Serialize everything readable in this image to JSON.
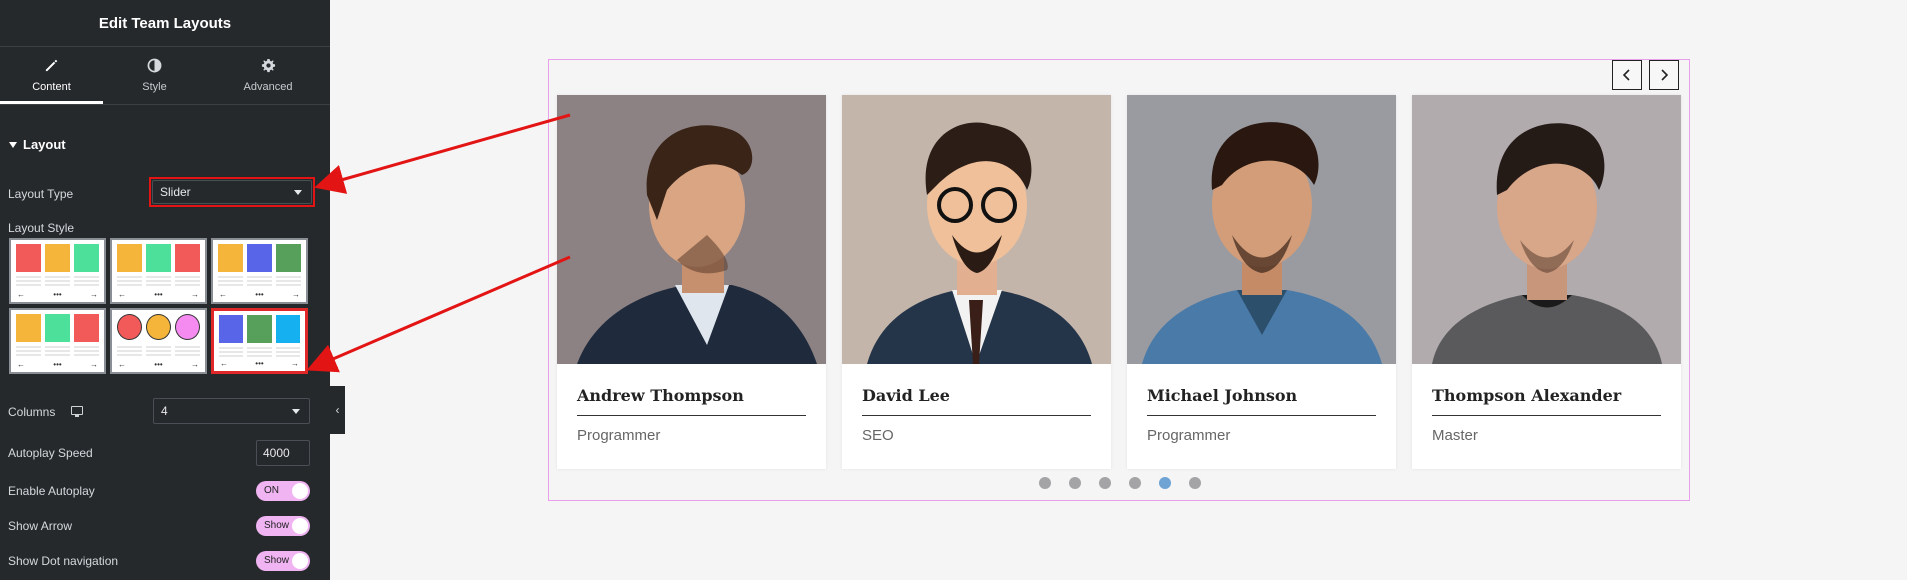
{
  "panel": {
    "title": "Edit Team Layouts",
    "tabs": [
      {
        "label": "Content",
        "icon": "pencil-icon",
        "active": true
      },
      {
        "label": "Style",
        "icon": "half-circle-icon",
        "active": false
      },
      {
        "label": "Advanced",
        "icon": "gear-icon",
        "active": false
      }
    ],
    "section_title": "Layout",
    "layout_type_label": "Layout Type",
    "layout_type_value": "Slider",
    "layout_style_label": "Layout Style",
    "layout_styles": [
      {
        "colors": [
          "#f25a5a",
          "#f5b43a",
          "#4ce09a"
        ],
        "shape": "square",
        "selected": false
      },
      {
        "colors": [
          "#f5b43a",
          "#4ce09a",
          "#f25a5a"
        ],
        "shape": "square",
        "selected": false
      },
      {
        "colors": [
          "#f5b43a",
          "#5865e8",
          "#57a05c"
        ],
        "shape": "square",
        "selected": false
      },
      {
        "colors": [
          "#f5b43a",
          "#4ce09a",
          "#f25a5a"
        ],
        "shape": "square",
        "selected": false
      },
      {
        "colors": [
          "#f25a5a",
          "#f5b43a",
          "#f58af0"
        ],
        "shape": "circle",
        "selected": false
      },
      {
        "colors": [
          "#5865e8",
          "#57a05c",
          "#15b0f0"
        ],
        "shape": "square",
        "selected": true
      }
    ],
    "columns_label": "Columns",
    "columns_device_icon": "monitor-icon",
    "columns_value": "4",
    "autoplay_speed_label": "Autoplay Speed",
    "autoplay_speed_value": "4000",
    "enable_autoplay_label": "Enable Autoplay",
    "enable_autoplay_value": "ON",
    "show_arrow_label": "Show Arrow",
    "show_arrow_value": "Show",
    "show_dot_label": "Show Dot navigation",
    "show_dot_value": "Show",
    "toggle_color": "#f0b4f2"
  },
  "preview": {
    "border_color": "#e8a0ea",
    "members": [
      {
        "name": "Andrew Thompson",
        "role": "Programmer",
        "photo": "portrait-profile",
        "bg": "#8c8283"
      },
      {
        "name": "David Lee",
        "role": "SEO",
        "photo": "portrait-glasses",
        "bg": "#c4b5aa"
      },
      {
        "name": "Michael Johnson",
        "role": "Programmer",
        "photo": "portrait-denim",
        "bg": "#9a9ba0"
      },
      {
        "name": "Thompson Alexander",
        "role": "Master",
        "photo": "portrait-tshirt",
        "bg": "#b1abae"
      }
    ],
    "dots": [
      false,
      false,
      false,
      false,
      true,
      false
    ],
    "active_dot_color": "#6fa3d4",
    "annotation_arrow_color": "#e31414"
  }
}
